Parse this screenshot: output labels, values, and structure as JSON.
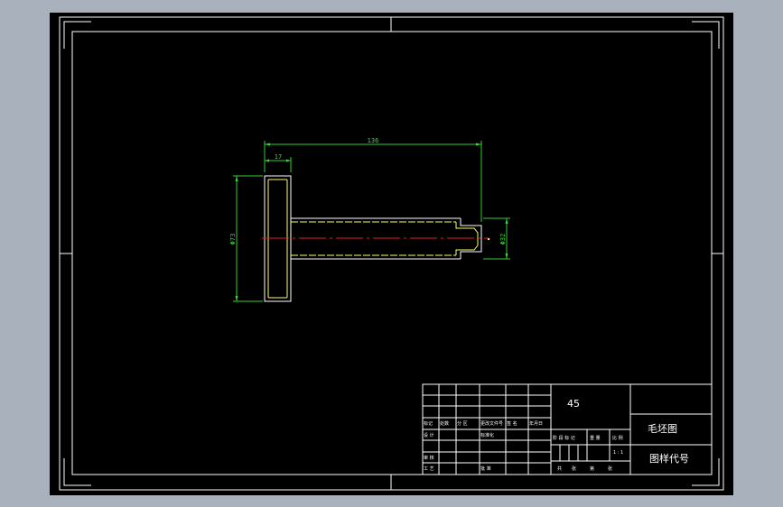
{
  "drawing": {
    "dimensions": {
      "overall_length": "136",
      "flange_thickness": "17",
      "flange_diameter": "Φ73",
      "shaft_diameter": "Φ32"
    },
    "title_block": {
      "material": "45",
      "drawing_name": "毛坯图",
      "drawing_code_label": "图样代号",
      "left_grid_labels": [
        "标记",
        "处数",
        "分 区",
        "更改文件号",
        "签 名",
        "年月日"
      ],
      "left_grid_row2": [
        "设 计",
        "标准化"
      ],
      "left_grid_row3": [
        "审 核"
      ],
      "left_grid_row4": [
        "工 艺",
        "批 准"
      ],
      "right_grid_labels": [
        "阶 段 标 记",
        "重 量",
        "比 例"
      ],
      "right_grid_bottom": [
        "共",
        "张",
        "第",
        "张"
      ],
      "scale_marks": "1 : 1"
    }
  }
}
